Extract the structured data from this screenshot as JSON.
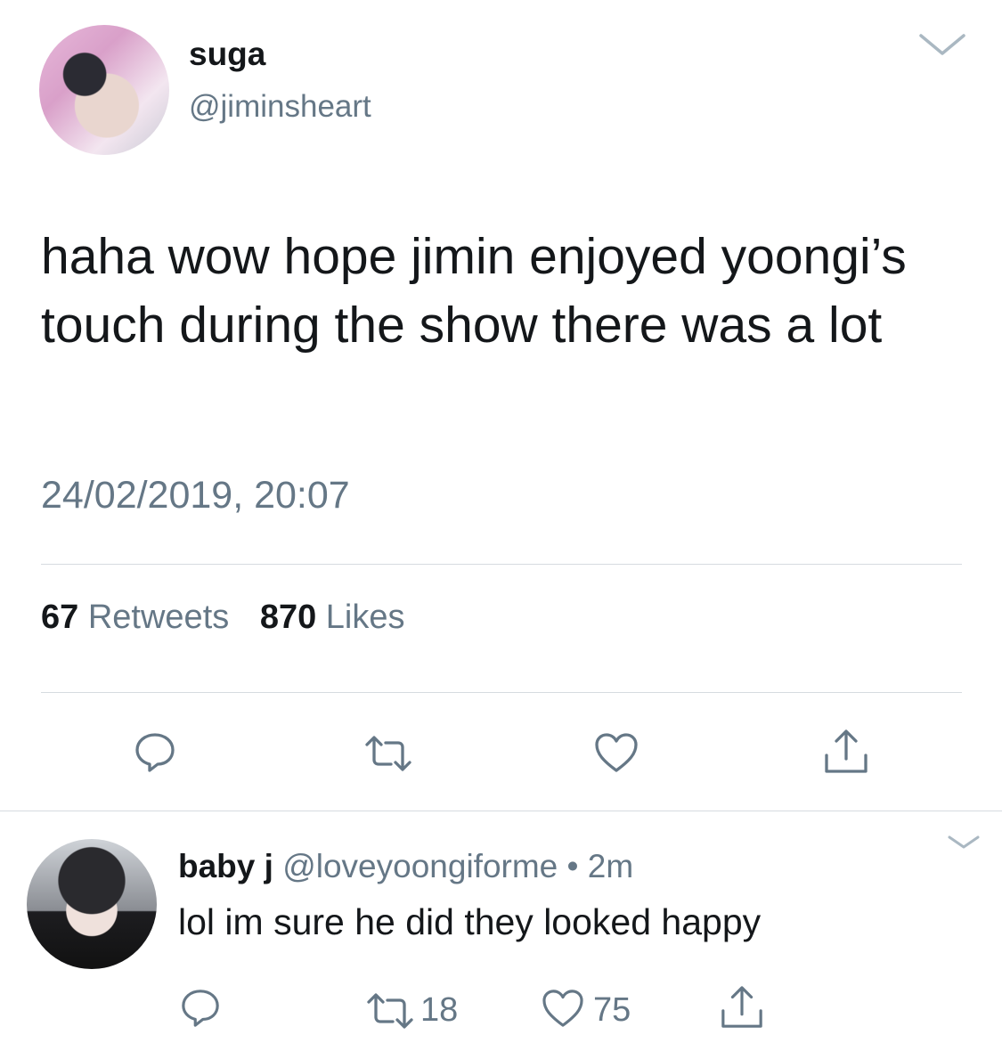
{
  "tweet": {
    "author_name": "suga",
    "author_handle": "@jiminsheart",
    "text": "haha wow hope jimin enjoyed yoongi’s touch during the show there was a lot",
    "timestamp": "24/02/2019, 20:07",
    "retweets_count": "67",
    "retweets_label": "Retweets",
    "likes_count": "870",
    "likes_label": "Likes"
  },
  "reply": {
    "author_name": "baby j",
    "author_handle": "@loveyoongiforme",
    "separator": "•",
    "time_ago": "2m",
    "text": "lol im sure he did they looked happy",
    "retweets_count": "18",
    "likes_count": "75"
  },
  "icons": {
    "reply": "reply-icon",
    "retweet": "retweet-icon",
    "like": "heart-icon",
    "share": "share-icon",
    "menu": "chevron-down-icon"
  },
  "colors": {
    "text": "#14171a",
    "secondary": "#657786",
    "icon": "#657786",
    "divider": "#d6dbe0"
  }
}
